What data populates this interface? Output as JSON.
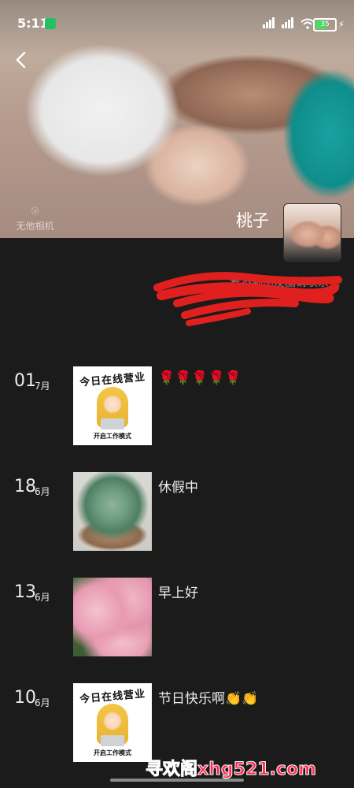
{
  "status_bar": {
    "time": "5:11",
    "battery": "35"
  },
  "profile": {
    "name": "桃子",
    "camera_watermark": "无他相机",
    "signature": "看不到朋友圈请联系我"
  },
  "posts": [
    {
      "day": "01",
      "month": "7月",
      "text": "🌹🌹🌹🌹🌹",
      "thumbnail": "今日在线营业",
      "thumbnail_sub": "开启工作模式"
    },
    {
      "day": "18",
      "month": "6月",
      "text": "休假中",
      "thumbnail": "succulent-photo"
    },
    {
      "day": "13",
      "month": "6月",
      "text": "早上好",
      "thumbnail": "pink-flowers-photo"
    },
    {
      "day": "10",
      "month": "6月",
      "text": "节日快乐啊👏👏",
      "thumbnail": "今日在线营业",
      "thumbnail_sub": "开启工作模式"
    }
  ],
  "watermark": {
    "site": "寻欢阁xhg521.com",
    "color": "#ff2d55"
  }
}
